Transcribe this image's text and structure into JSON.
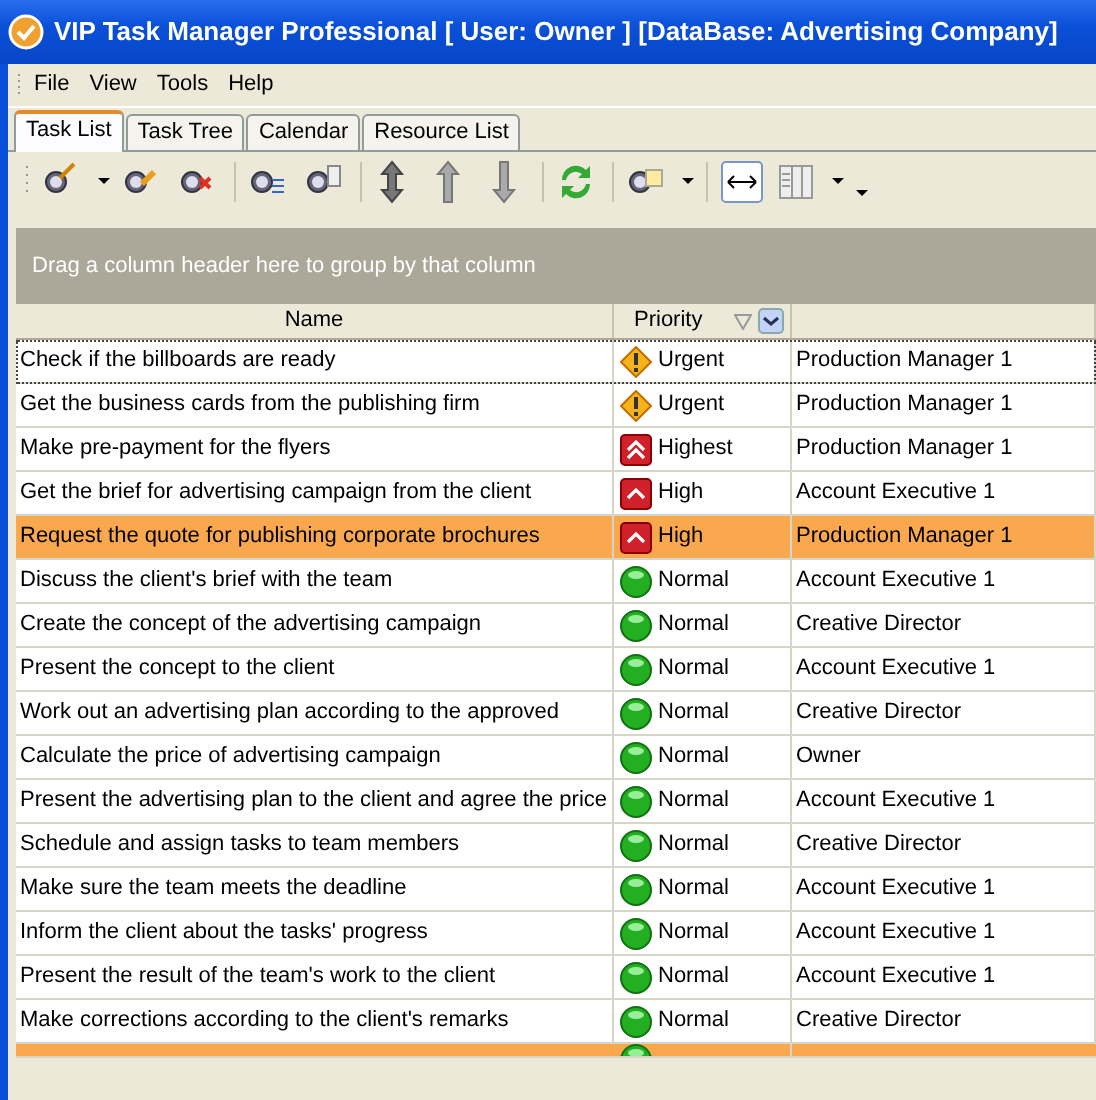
{
  "window": {
    "title": "VIP Task Manager Professional [ User: Owner ] [DataBase: Advertising Company]"
  },
  "menu": [
    "File",
    "View",
    "Tools",
    "Help"
  ],
  "tabs": [
    {
      "label": "Task List",
      "selected": true
    },
    {
      "label": "Task Tree",
      "selected": false
    },
    {
      "label": "Calendar",
      "selected": false
    },
    {
      "label": "Resource List",
      "selected": false
    }
  ],
  "group_panel": {
    "text": "Drag a column header here to group by that column"
  },
  "table": {
    "columns": [
      "Name",
      "Priority"
    ],
    "rows": [
      {
        "name": "Check if the billboards are ready",
        "priority": "Urgent",
        "kind": "urgent",
        "resource": "Production Manager 1",
        "selected": false,
        "focused": true
      },
      {
        "name": "Get the business cards from the publishing firm",
        "priority": "Urgent",
        "kind": "urgent",
        "resource": "Production Manager 1",
        "selected": false,
        "focused": false
      },
      {
        "name": "Make pre-payment for the flyers",
        "priority": "Highest",
        "kind": "highest",
        "resource": "Production Manager 1",
        "selected": false,
        "focused": false
      },
      {
        "name": "Get the brief for advertising campaign from the client",
        "priority": "High",
        "kind": "high",
        "resource": "Account Executive 1",
        "selected": false,
        "focused": false
      },
      {
        "name": "Request the quote for publishing corporate brochures",
        "priority": "High",
        "kind": "high",
        "resource": "Production Manager 1",
        "selected": true,
        "focused": false
      },
      {
        "name": "Discuss the client's brief with the team",
        "priority": "Normal",
        "kind": "normal",
        "resource": "Account Executive 1",
        "selected": false,
        "focused": false
      },
      {
        "name": "Create the concept of the advertising campaign",
        "priority": "Normal",
        "kind": "normal",
        "resource": "Creative Director",
        "selected": false,
        "focused": false
      },
      {
        "name": "Present the concept to the client",
        "priority": "Normal",
        "kind": "normal",
        "resource": "Account Executive 1",
        "selected": false,
        "focused": false
      },
      {
        "name": "Work out an advertising plan according to the approved",
        "priority": "Normal",
        "kind": "normal",
        "resource": "Creative Director",
        "selected": false,
        "focused": false
      },
      {
        "name": "Calculate the price of advertising campaign",
        "priority": "Normal",
        "kind": "normal",
        "resource": "Owner",
        "selected": false,
        "focused": false
      },
      {
        "name": "Present the advertising plan to the client and agree the price",
        "priority": "Normal",
        "kind": "normal",
        "resource": "Account Executive 1",
        "selected": false,
        "focused": false
      },
      {
        "name": "Schedule and assign tasks to team members",
        "priority": "Normal",
        "kind": "normal",
        "resource": "Creative Director",
        "selected": false,
        "focused": false
      },
      {
        "name": "Make sure the team meets the deadline",
        "priority": "Normal",
        "kind": "normal",
        "resource": "Account Executive 1",
        "selected": false,
        "focused": false
      },
      {
        "name": "Inform the client about the tasks' progress",
        "priority": "Normal",
        "kind": "normal",
        "resource": "Account Executive 1",
        "selected": false,
        "focused": false
      },
      {
        "name": "Present the result of the team's work to the client",
        "priority": "Normal",
        "kind": "normal",
        "resource": "Account Executive 1",
        "selected": false,
        "focused": false
      },
      {
        "name": "Make corrections according to the client's remarks",
        "priority": "Normal",
        "kind": "normal",
        "resource": "Creative Director",
        "selected": false,
        "focused": false
      },
      {
        "kind": "normal",
        "selected": true,
        "focused": false
      }
    ]
  }
}
